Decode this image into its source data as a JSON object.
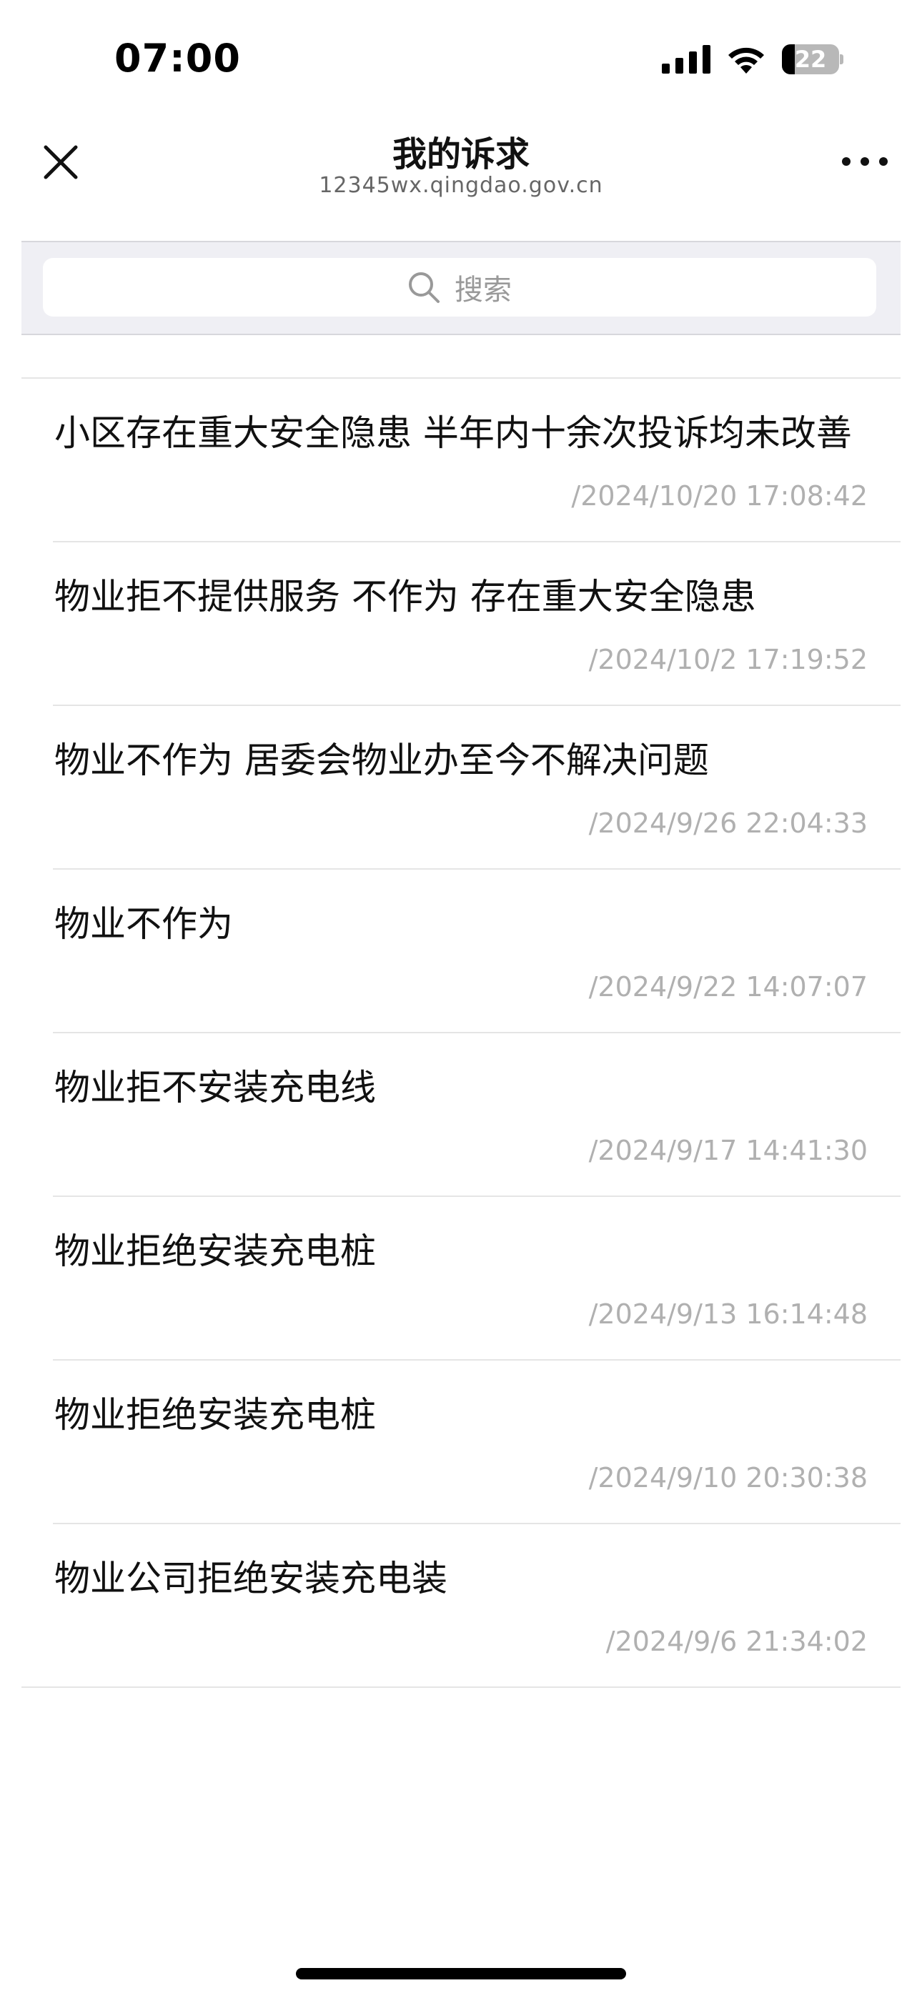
{
  "status_bar": {
    "time": "07:00",
    "battery_level": "22",
    "battery_fraction": 0.22,
    "icons": [
      "signal-icon",
      "wifi-icon",
      "battery-icon"
    ]
  },
  "nav": {
    "title": "我的诉求",
    "subtitle": "12345wx.qingdao.gov.cn",
    "close_icon": "close-icon",
    "more_icon": "more-icon"
  },
  "search": {
    "placeholder": "搜索",
    "icon": "search-icon"
  },
  "items": [
    {
      "title": "小区存在重大安全隐患 半年内十余次投诉均未改善",
      "time": "/2024/10/20 17:08:42"
    },
    {
      "title": "物业拒不提供服务 不作为 存在重大安全隐患",
      "time": "/2024/10/2 17:19:52"
    },
    {
      "title": "物业不作为 居委会物业办至今不解决问题",
      "time": "/2024/9/26 22:04:33"
    },
    {
      "title": "物业不作为",
      "time": "/2024/9/22 14:07:07"
    },
    {
      "title": "物业拒不安装充电线",
      "time": "/2024/9/17 14:41:30"
    },
    {
      "title": "物业拒绝安装充电桩",
      "time": "/2024/9/13 16:14:48"
    },
    {
      "title": "物业拒绝安装充电桩",
      "time": "/2024/9/10 20:30:38"
    },
    {
      "title": "物业公司拒绝安装充电装",
      "time": "/2024/9/6 21:34:02"
    }
  ],
  "colors": {
    "text_primary": "#111111",
    "text_secondary": "#b0b0b0",
    "search_bg": "#efeff4",
    "divider": "#e5e5e5"
  }
}
